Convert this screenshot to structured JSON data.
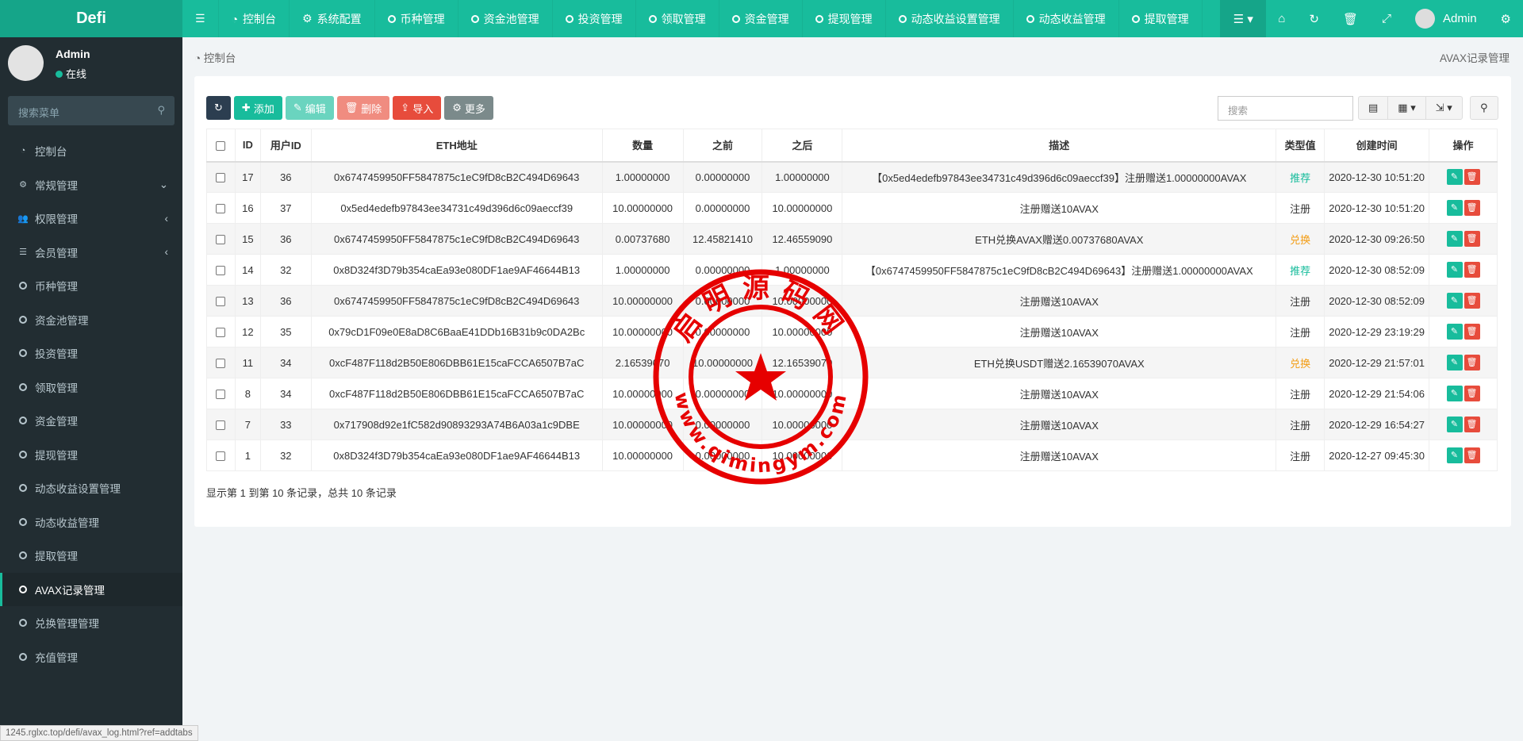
{
  "app": {
    "logo": "Defi"
  },
  "topnav": {
    "items": [
      {
        "label": "控制台",
        "icon": "dashboard-icon"
      },
      {
        "label": "系统配置",
        "icon": "gear-icon"
      },
      {
        "label": "币种管理",
        "icon": "circle-icon"
      },
      {
        "label": "资金池管理",
        "icon": "circle-icon"
      },
      {
        "label": "投资管理",
        "icon": "circle-icon"
      },
      {
        "label": "领取管理",
        "icon": "circle-icon"
      },
      {
        "label": "资金管理",
        "icon": "circle-icon"
      },
      {
        "label": "提现管理",
        "icon": "circle-icon"
      },
      {
        "label": "动态收益设置管理",
        "icon": "circle-icon"
      },
      {
        "label": "动态收益管理",
        "icon": "circle-icon"
      },
      {
        "label": "提取管理",
        "icon": "circle-icon"
      }
    ],
    "user": "Admin"
  },
  "sidebar": {
    "user": "Admin",
    "status": "在线",
    "search_placeholder": "搜索菜单",
    "items": [
      {
        "label": "控制台",
        "icon": "dashboard-icon"
      },
      {
        "label": "常规管理",
        "icon": "cogs-icon",
        "chev": "⌄"
      },
      {
        "label": "权限管理",
        "icon": "users-icon",
        "chev": "‹"
      },
      {
        "label": "会员管理",
        "icon": "list-icon",
        "chev": "‹"
      },
      {
        "label": "币种管理"
      },
      {
        "label": "资金池管理"
      },
      {
        "label": "投资管理"
      },
      {
        "label": "领取管理"
      },
      {
        "label": "资金管理"
      },
      {
        "label": "提现管理"
      },
      {
        "label": "动态收益设置管理"
      },
      {
        "label": "动态收益管理"
      },
      {
        "label": "提取管理"
      },
      {
        "label": "AVAX记录管理",
        "active": true
      },
      {
        "label": "兑换管理管理"
      },
      {
        "label": "充值管理"
      }
    ]
  },
  "breadcrumb": {
    "home": "控制台",
    "current": "AVAX记录管理"
  },
  "toolbar": {
    "add": "添加",
    "edit": "编辑",
    "delete": "删除",
    "import": "导入",
    "more": "更多",
    "search_placeholder": "搜索"
  },
  "table": {
    "headers": [
      "ID",
      "用户ID",
      "ETH地址",
      "数量",
      "之前",
      "之后",
      "描述",
      "类型值",
      "创建时间",
      "操作"
    ],
    "rows": [
      [
        "17",
        "36",
        "0x6747459950FF5847875c1eC9fD8cB2C494D69643",
        "1.00000000",
        "0.00000000",
        "1.00000000",
        "【0x5ed4edefb97843ee34731c49d396d6c09aeccf39】注册赠送1.00000000AVAX",
        "推荐",
        "2020-12-30 10:51:20"
      ],
      [
        "16",
        "37",
        "0x5ed4edefb97843ee34731c49d396d6c09aeccf39",
        "10.00000000",
        "0.00000000",
        "10.00000000",
        "注册赠送10AVAX",
        "注册",
        "2020-12-30 10:51:20"
      ],
      [
        "15",
        "36",
        "0x6747459950FF5847875c1eC9fD8cB2C494D69643",
        "0.00737680",
        "12.45821410",
        "12.46559090",
        "ETH兑换AVAX赠送0.00737680AVAX",
        "兑换",
        "2020-12-30 09:26:50"
      ],
      [
        "14",
        "32",
        "0x8D324f3D79b354caEa93e080DF1ae9AF46644B13",
        "1.00000000",
        "0.00000000",
        "1.00000000",
        "【0x6747459950FF5847875c1eC9fD8cB2C494D69643】注册赠送1.00000000AVAX",
        "推荐",
        "2020-12-30 08:52:09"
      ],
      [
        "13",
        "36",
        "0x6747459950FF5847875c1eC9fD8cB2C494D69643",
        "10.00000000",
        "0.00000000",
        "10.00000000",
        "注册赠送10AVAX",
        "注册",
        "2020-12-30 08:52:09"
      ],
      [
        "12",
        "35",
        "0x79cD1F09e0E8aD8C6BaaE41DDb16B31b9c0DA2Bc",
        "10.00000000",
        "0.00000000",
        "10.00000000",
        "注册赠送10AVAX",
        "注册",
        "2020-12-29 23:19:29"
      ],
      [
        "11",
        "34",
        "0xcF487F118d2B50E806DBB61E15caFCCA6507B7aC",
        "2.16539070",
        "10.00000000",
        "12.16539070",
        "ETH兑换USDT赠送2.16539070AVAX",
        "兑换",
        "2020-12-29 21:57:01"
      ],
      [
        "8",
        "34",
        "0xcF487F118d2B50E806DBB61E15caFCCA6507B7aC",
        "10.00000000",
        "0.00000000",
        "10.00000000",
        "注册赠送10AVAX",
        "注册",
        "2020-12-29 21:54:06"
      ],
      [
        "7",
        "33",
        "0x717908d92e1fC582d90893293A74B6A03a1c9DBE",
        "10.00000000",
        "0.00000000",
        "10.00000000",
        "注册赠送10AVAX",
        "注册",
        "2020-12-29 16:54:27"
      ],
      [
        "1",
        "32",
        "0x8D324f3D79b354caEa93e080DF1ae9AF46644B13",
        "10.00000000",
        "0.00000000",
        "10.00000000",
        "注册赠送10AVAX",
        "注册",
        "2020-12-27 09:45:30"
      ]
    ]
  },
  "type_colors": {
    "推荐": "#18bc9c",
    "注册": "#333333",
    "兑换": "#f39c12"
  },
  "pagination": "显示第 1 到第 10 条记录，总共 10 条记录",
  "status_url": "1245.rglxc.top/defi/avax_log.html?ref=addtabs",
  "stamp": {
    "name": "启明源码网",
    "url": "www.qimingym.com"
  }
}
